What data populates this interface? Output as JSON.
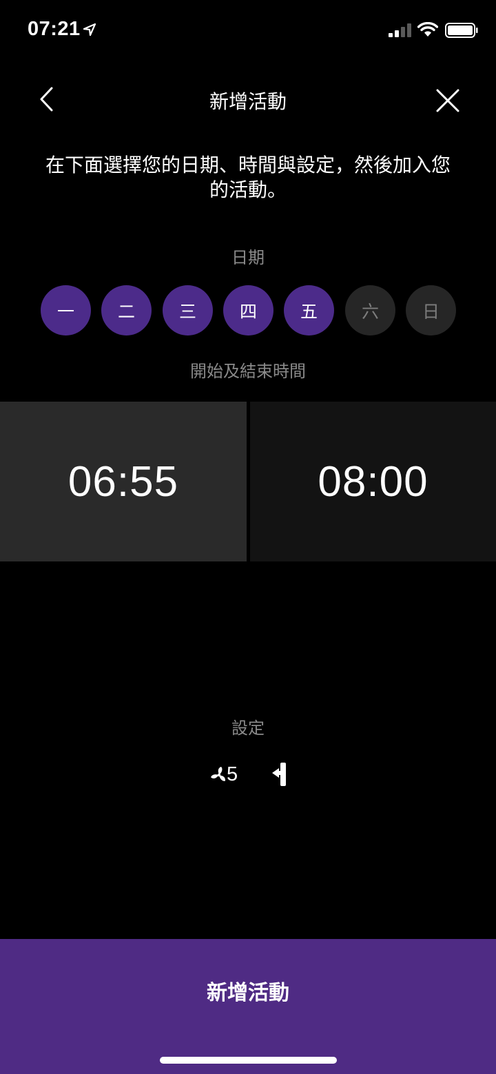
{
  "status_bar": {
    "time": "07:21"
  },
  "nav": {
    "title": "新增活動",
    "back_icon": "chevron-left-icon",
    "close_icon": "close-icon"
  },
  "instructions": "在下面選擇您的日期、時間與設定，然後加入您的活動。",
  "date_section": {
    "label": "日期",
    "days": [
      {
        "label": "一",
        "selected": true
      },
      {
        "label": "二",
        "selected": true
      },
      {
        "label": "三",
        "selected": true
      },
      {
        "label": "四",
        "selected": true
      },
      {
        "label": "五",
        "selected": true
      },
      {
        "label": "六",
        "selected": false
      },
      {
        "label": "日",
        "selected": false
      }
    ]
  },
  "time_section": {
    "label": "開始及結束時間",
    "start": "06:55",
    "end": "08:00"
  },
  "settings_section": {
    "label": "設定",
    "fan_icon": "fan-icon",
    "fan_speed": "5",
    "door_icon": "door-icon"
  },
  "add_button": {
    "label": "新增活動"
  },
  "colors": {
    "accent": "#4f2b84",
    "day_selected": "#4c2b8a",
    "day_unselected": "#262626",
    "time_start_bg": "#2a2a2a",
    "time_end_bg": "#131313"
  }
}
